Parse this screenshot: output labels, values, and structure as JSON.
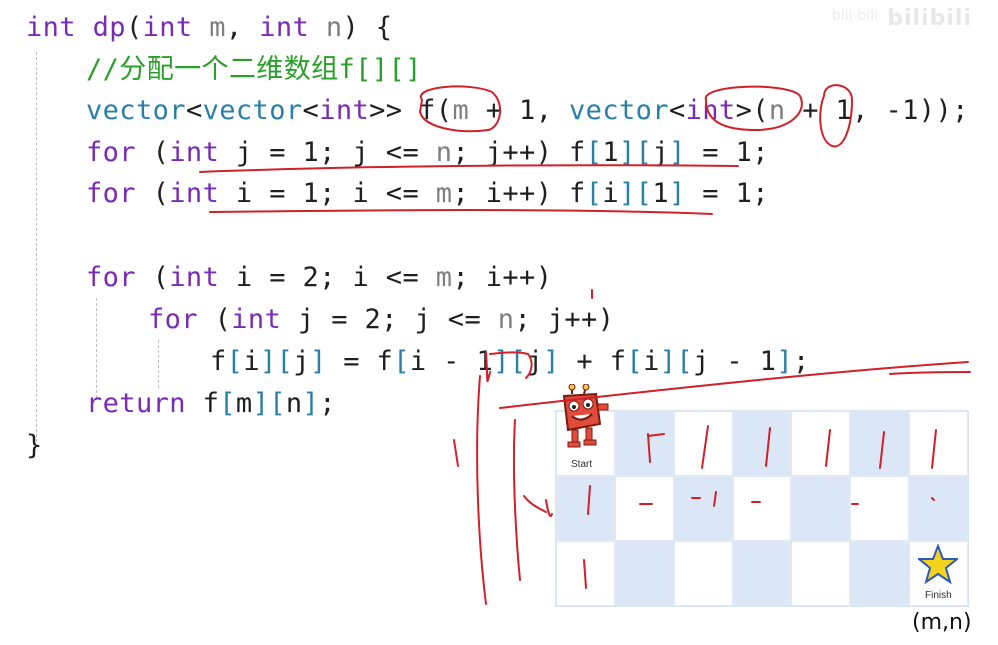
{
  "watermark": "bilibili",
  "watermark_small": "bili-bili",
  "code": {
    "l1": {
      "kw1": "int",
      "fn": "dp",
      "p1": "(",
      "kw2": "int",
      "v1": "m",
      ",": ",",
      "kw3": "int",
      "v2": "n",
      "end": ") {"
    },
    "l2": {
      "comment": "//分配一个二维数组f[][]"
    },
    "l3": {
      "ty1": "vector",
      "a": "<",
      "ty2": "vector",
      "b": "<",
      "kw": "int",
      "c": ">> f(",
      "v1": "m",
      "d": " + 1, ",
      "ty3": "vector",
      "e": "<",
      "kw2": "int",
      "f": ">(",
      "v2": "n",
      "g": " + 1, -1));"
    },
    "l4": {
      "kw": "for",
      "a": " (",
      "kw2": "int",
      "b": " j = 1; j <= ",
      "v": "n",
      "c": "; j++) ",
      "f": "f",
      "br1": "[",
      "one": "1",
      "br2": "][",
      "j": "j",
      "br3": "]",
      "eq": " = 1;"
    },
    "l5": {
      "kw": "for",
      "a": " (",
      "kw2": "int",
      "b": " i = 1; i <= ",
      "v": "m",
      "c": "; i++) ",
      "f": "f",
      "br1": "[",
      "i": "i",
      "br2": "][",
      "one": "1",
      "br3": "]",
      "eq": " = 1;"
    },
    "l6": {
      "kw": "for",
      "a": " (",
      "kw2": "int",
      "b": " i = 2; i <= ",
      "v": "m",
      "c": "; i++)"
    },
    "l7": {
      "kw": "for",
      "a": " (",
      "kw2": "int",
      "b": " j = 2; j <= ",
      "v": "n",
      "c": "; j++)"
    },
    "l8": {
      "text1": "f",
      "b1": "[",
      "i1": "i",
      "b2": "][",
      "j1": "j",
      "b3": "]",
      "mid": " = f",
      "b4": "[",
      "i2": "i - 1",
      "b5": "][",
      "j2": "j",
      "b6": "]",
      "plus": " + f",
      "b7": "[",
      "i3": "i",
      "b8": "][",
      "j3": "j - 1",
      "b9": "]",
      "end": ";"
    },
    "l9": {
      "kw": "return",
      "a": " f",
      "b1": "[",
      "m": "m",
      "b2": "][",
      "n": "n",
      "b3": "]",
      "end": ";"
    },
    "l10": {
      "brace": "}"
    }
  },
  "board": {
    "rows": 3,
    "cols": 7,
    "start_label": "Start",
    "finish_label": "Finish",
    "corner_label": "(m,n)"
  },
  "colors": {
    "keyword": "#7a2bb6",
    "type": "#2a7fa8",
    "comment": "#2aa02a",
    "param": "#7f7f7f",
    "ink": "#d0202a",
    "board_blue": "#dbe6f6"
  }
}
